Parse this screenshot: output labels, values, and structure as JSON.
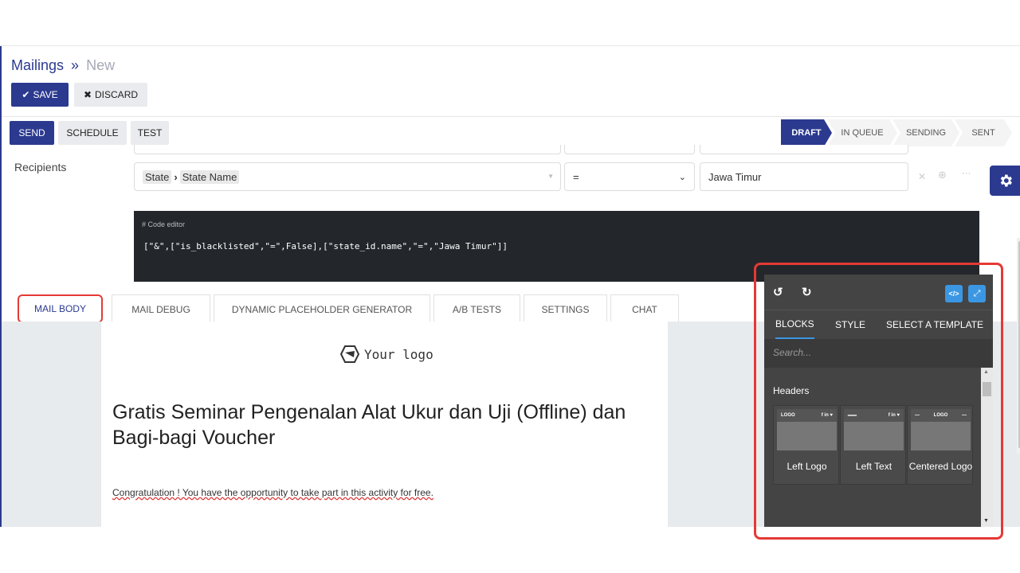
{
  "breadcrumb": {
    "parent": "Mailings",
    "separator": "»",
    "current": "New"
  },
  "form_buttons": {
    "save": "SAVE",
    "discard": "DISCARD"
  },
  "action_buttons": {
    "send": "SEND",
    "schedule": "SCHEDULE",
    "test": "TEST"
  },
  "stages": [
    {
      "label": "DRAFT",
      "active": true
    },
    {
      "label": "IN QUEUE",
      "active": false
    },
    {
      "label": "SENDING",
      "active": false
    },
    {
      "label": "SENT",
      "active": false
    }
  ],
  "recipients": {
    "label": "Recipients",
    "field_path": {
      "part1": "State",
      "arrow": "›",
      "part2": "State Name"
    },
    "operator": "=",
    "value": "Jawa Timur"
  },
  "code_editor": {
    "header": "# Code editor",
    "domain": "[\"&\",[\"is_blacklisted\",\"=\",False],[\"state_id.name\",\"=\",\"Jawa Timur\"]]"
  },
  "tabs": [
    "MAIL BODY",
    "MAIL DEBUG",
    "DYNAMIC PLACEHOLDER GENERATOR",
    "A/B TESTS",
    "SETTINGS",
    "CHAT"
  ],
  "mail": {
    "logo_text": "Your logo",
    "heading": "Gratis Seminar Pengenalan Alat Ukur dan Uji (Offline) dan Bagi-bagi Voucher",
    "paragraph": "Congratulation ! You have the opportunity to take part in this activity for free."
  },
  "builder": {
    "tabs": [
      "BLOCKS",
      "STYLE",
      "SELECT A TEMPLATE"
    ],
    "search_placeholder": "Search...",
    "section": "Headers",
    "blocks": [
      {
        "label": "Left Logo",
        "thumb_left": "LOGO",
        "thumb_right": "f in ♥"
      },
      {
        "label": "Left Text",
        "thumb_left": "━━━",
        "thumb_right": "f in ♥"
      },
      {
        "label": "Centered Logo",
        "thumb_left": "—",
        "thumb_center": "LOGO",
        "thumb_right": "—"
      }
    ]
  },
  "colors": {
    "primary": "#2b3a8f",
    "highlight": "#e53935",
    "builder_accent": "#3b97e3",
    "code_bg": "#23272b"
  }
}
